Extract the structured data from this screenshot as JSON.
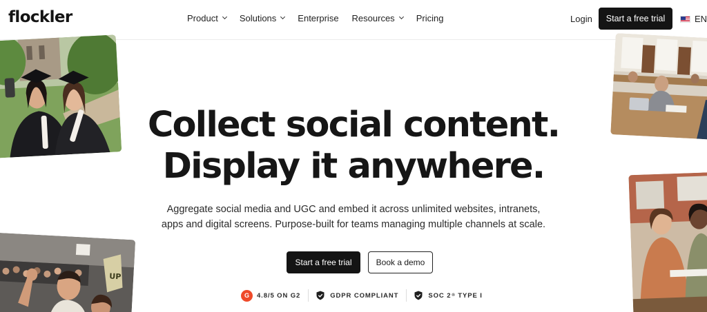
{
  "header": {
    "logo": "flockler",
    "nav": [
      {
        "label": "Product",
        "has_dropdown": true
      },
      {
        "label": "Solutions",
        "has_dropdown": true
      },
      {
        "label": "Enterprise",
        "has_dropdown": false
      },
      {
        "label": "Resources",
        "has_dropdown": true
      },
      {
        "label": "Pricing",
        "has_dropdown": false
      }
    ],
    "login": "Login",
    "cta": "Start a free trial",
    "language": "EN",
    "language_flag_icon": "us-flag-icon"
  },
  "hero": {
    "headline_line1": "Collect social content.",
    "headline_line2": "Display it anywhere.",
    "subtitle_line1": "Aggregate social media and UGC and embed it across unlimited websites, intranets,",
    "subtitle_line2": "apps and digital screens. Purpose-built for teams managing multiple channels at scale.",
    "primary_cta": "Start a free trial",
    "secondary_cta": "Book a demo"
  },
  "badges": {
    "g2": {
      "icon": "g2-logo-icon",
      "logo_letter": "G",
      "label": "4.8/5 ON G2"
    },
    "gdpr": {
      "icon": "shield-check-icon",
      "label": "GDPR COMPLIANT"
    },
    "soc": {
      "icon": "shield-check-icon",
      "label_prefix": "SOC 2",
      "superscript": "®",
      "label_suffix": "TYPE I"
    }
  },
  "photos": [
    {
      "name": "graduates-selfie-photo"
    },
    {
      "name": "library-students-photo"
    },
    {
      "name": "basketball-fans-photo"
    },
    {
      "name": "students-discussion-photo"
    }
  ],
  "colors": {
    "brand_dark": "#141414",
    "g2_red": "#ef4a2a",
    "background": "#ffffff"
  }
}
